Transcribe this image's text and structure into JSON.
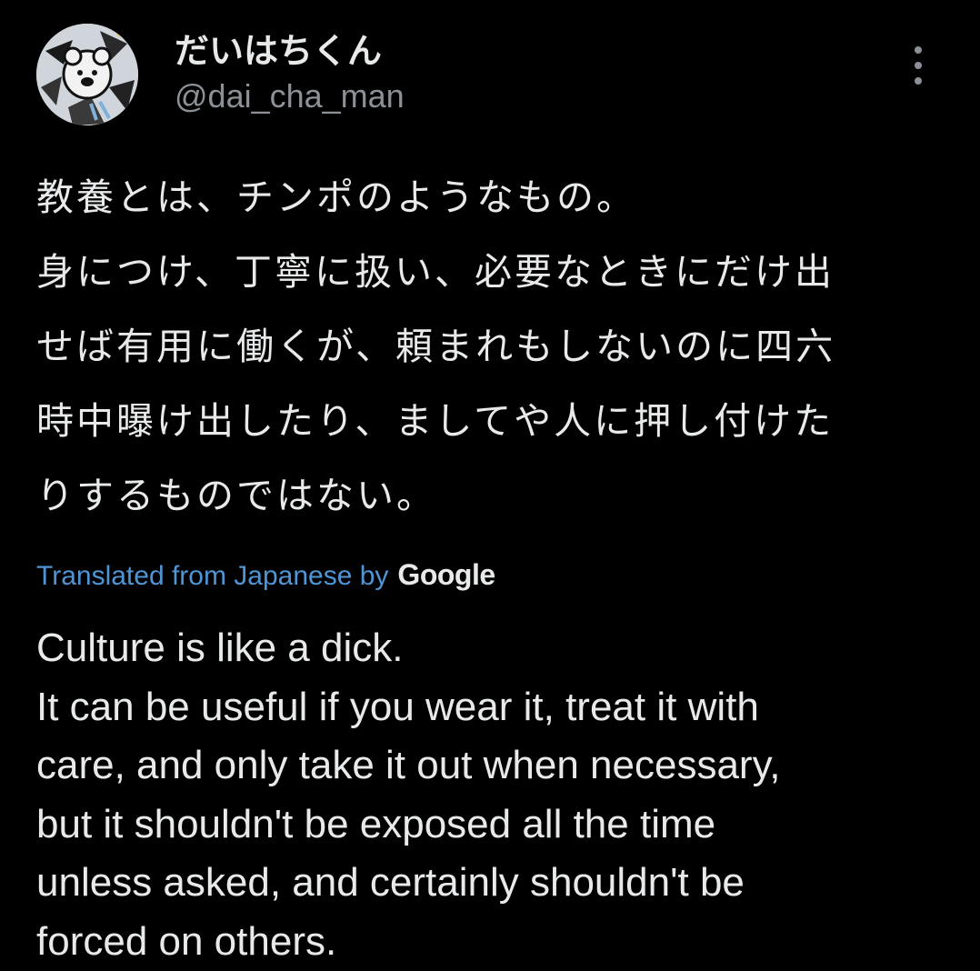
{
  "author": {
    "display_name": "だいはちくん",
    "handle": "@dai_cha_man",
    "avatar_icon": "avatar-icon"
  },
  "more_icon": "more-vertical-icon",
  "tweet": {
    "original_lines": [
      "教養とは、チンポのようなもの。",
      "身につけ、丁寧に扱い、必要なときにだけ出",
      "せば有用に働くが、頼まれもしないのに四六",
      "時中曝け出したり、ましてや人に押し付けた",
      "りするものではない。"
    ],
    "translation_link": "Translated from Japanese by",
    "translation_provider": "Google",
    "translated_lines": [
      "Culture is like a dick.",
      "It can be useful if you wear it, treat it with",
      "care, and only take it out when necessary,",
      "but it shouldn't be exposed all the time",
      "unless asked, and certainly shouldn't be",
      "forced on others."
    ]
  },
  "colors": {
    "background": "#000000",
    "text": "#e7e9ea",
    "secondary": "#8b9197",
    "link": "#4f95d6"
  }
}
